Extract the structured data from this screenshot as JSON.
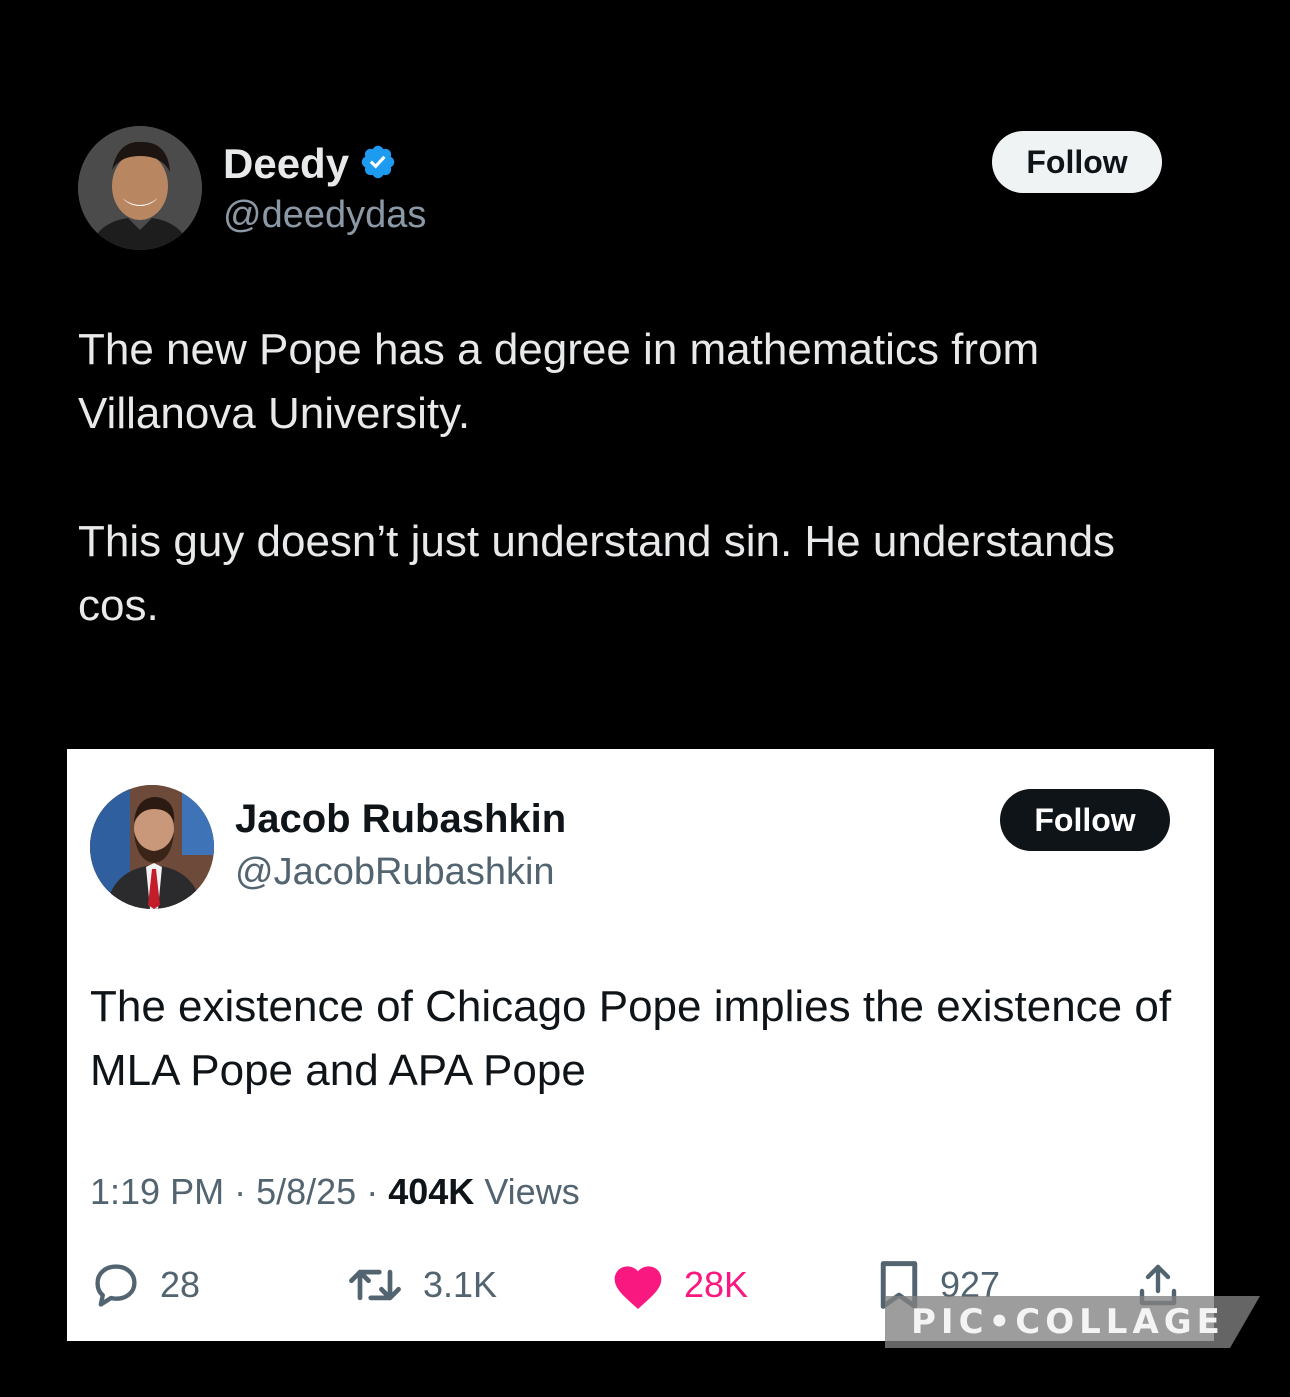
{
  "quoted_tweet": {
    "author": {
      "name": "Deedy",
      "handle": "@deedydas",
      "verified": true
    },
    "follow_label": "Follow",
    "paragraphs": [
      "The new Pope has a degree in mathematics from Villanova University.",
      "This guy doesn’t just understand sin. He understands cos."
    ]
  },
  "main_tweet": {
    "author": {
      "name": "Jacob Rubashkin",
      "handle": "@JacobRubashkin"
    },
    "follow_label": "Follow",
    "text": "The existence of Chicago Pope implies the existence of MLA Pope and APA Pope",
    "meta": {
      "time": "1:19 PM",
      "separator": "·",
      "date": "5/8/25",
      "views_count": "404K",
      "views_label": "Views"
    },
    "actions": {
      "replies": "28",
      "reposts": "3.1K",
      "likes": "28K",
      "bookmarks": "927"
    }
  },
  "watermark": "PIC•COLLAGE",
  "colors": {
    "dark_bg": "#000000",
    "verified_blue": "#1d9bf0",
    "like_pink": "#f91880",
    "muted_text": "#536471"
  },
  "icons": {
    "verified": "verified-badge-icon",
    "reply": "reply-icon",
    "repost": "repost-icon",
    "like": "heart-icon",
    "bookmark": "bookmark-icon",
    "share": "share-icon"
  }
}
